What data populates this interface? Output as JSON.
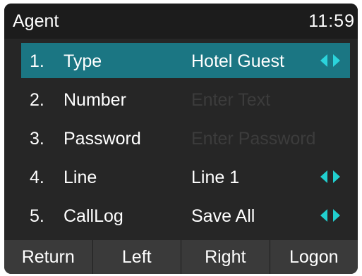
{
  "status": {
    "title": "Agent",
    "time": "11:59"
  },
  "menu": {
    "items": [
      {
        "num": "1.",
        "label": "Type",
        "value": "Hotel Guest",
        "has_arrows": true,
        "selected": true
      },
      {
        "num": "2.",
        "label": "Number",
        "placeholder": "Enter Text"
      },
      {
        "num": "3.",
        "label": "Password",
        "placeholder": "Enter Password"
      },
      {
        "num": "4.",
        "label": "Line",
        "value": "Line 1",
        "has_arrows": true
      },
      {
        "num": "5.",
        "label": "CallLog",
        "value": "Save All",
        "has_arrows": true
      }
    ]
  },
  "softkeys": {
    "return": "Return",
    "left": "Left",
    "right": "Right",
    "logon": "Logon"
  },
  "colors": {
    "selected_row": "#1b7683",
    "arrow": "#2bd4dc",
    "background": "#262626",
    "softkey_bar": "#3a3a3a"
  },
  "icons": {
    "arrow_left": "arrow-left-icon",
    "arrow_right": "arrow-right-icon"
  }
}
